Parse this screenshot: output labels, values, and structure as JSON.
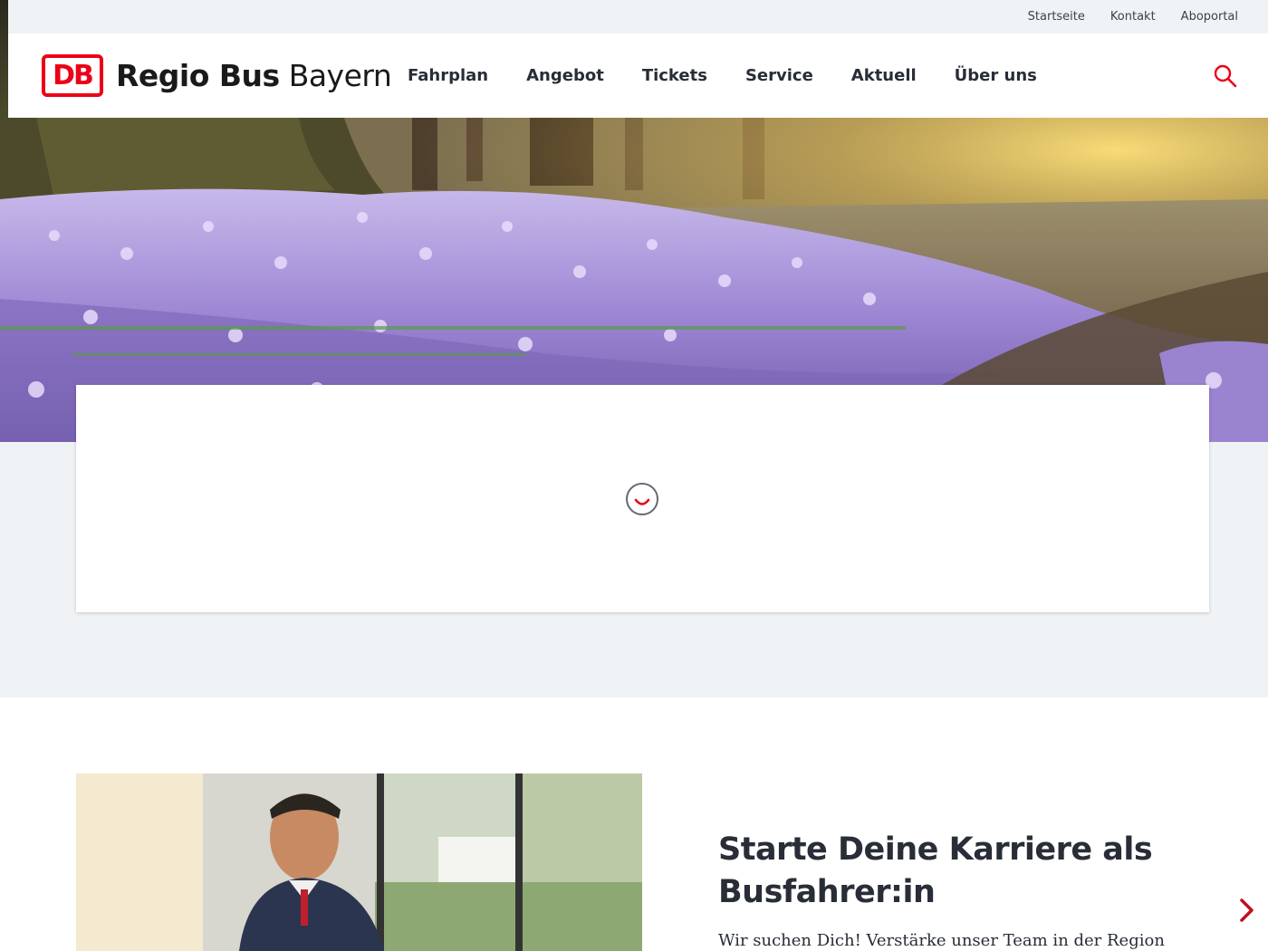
{
  "utility_nav": {
    "items": [
      "Startseite",
      "Kontakt",
      "Aboportal"
    ]
  },
  "header": {
    "logo_mark": "DB",
    "brand_bold": "Regio Bus",
    "brand_light": "Bayern",
    "nav": [
      "Fahrplan",
      "Angebot",
      "Tickets",
      "Service",
      "Aktuell",
      "Über uns"
    ],
    "search_icon": "search-icon"
  },
  "hero": {
    "image": "crocus-field-photo"
  },
  "loading_card": {
    "spinner_icon": "loading-spinner-icon"
  },
  "career": {
    "title": "Starte Deine Karriere als Busfahrer:in",
    "text": "Wir suchen Dich! Verstärke unser Team in der Region Bayern.",
    "image": "bus-driver-photo",
    "next_icon": "chevron-right-icon"
  },
  "colors": {
    "brand_red": "#ec0016",
    "text_dark": "#282d37",
    "bg_grey": "#f0f3f5"
  }
}
